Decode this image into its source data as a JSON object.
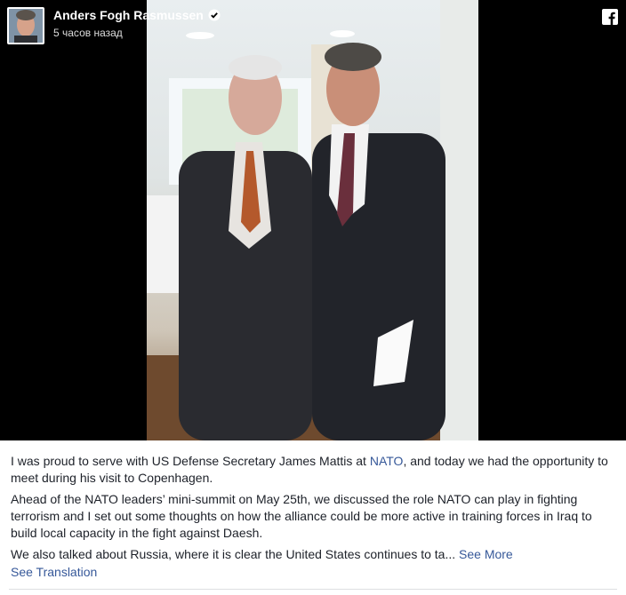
{
  "post": {
    "author": "Anders Fogh Rasmussen",
    "timestamp": "5 часов назад",
    "verified_icon": "verified-badge-icon",
    "platform_icon": "facebook-icon",
    "paragraph1_a": "I was proud to serve with US Defense Secretary James Mattis at ",
    "paragraph1_link": "NATO",
    "paragraph1_b": ", and today we had the opportunity to meet during his visit to Copenhagen.",
    "paragraph2": "Ahead of the NATO leaders’ mini-summit on May 25th, we discussed the role NATO can play in fighting terrorism and I set out some thoughts on how the alliance could be more active in training forces in Iraq to build local capacity in the fight against Daesh.",
    "paragraph3": "We also talked about Russia, where it is clear the United States continues to ta...",
    "see_more": "See More",
    "see_translation": "See Translation"
  },
  "colors": {
    "link": "#365899",
    "text": "#1d2129",
    "verified": "#ffffff"
  }
}
